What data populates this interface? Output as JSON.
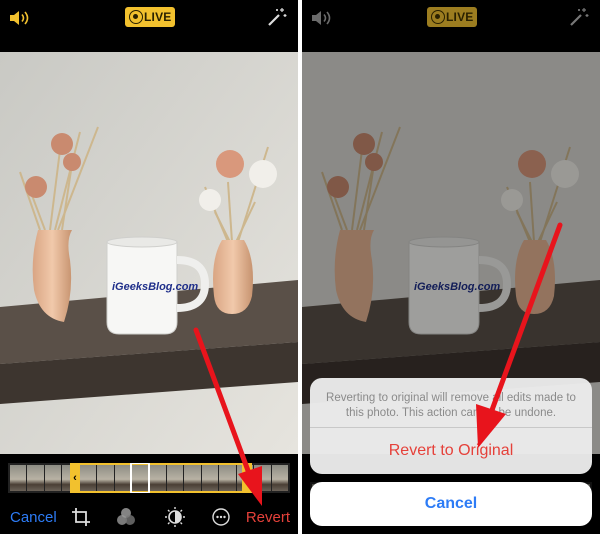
{
  "left_screen": {
    "live_badge": "LIVE",
    "mug_text": "iGeeksBlog.com",
    "toolbar": {
      "cancel_label": "Cancel",
      "revert_label": "Revert",
      "icons": [
        "crop-icon",
        "filters-icon",
        "adjust-icon",
        "more-icon"
      ]
    }
  },
  "right_screen": {
    "live_badge": "LIVE",
    "mug_text": "iGeeksBlog.com",
    "action_sheet": {
      "message": "Reverting to original will remove all edits made to this photo. This action cannot be undone.",
      "revert_button": "Revert to Original",
      "cancel_button": "Cancel"
    }
  },
  "colors": {
    "accent_blue": "#2d7cf6",
    "destructive_red": "#e5413a",
    "live_yellow": "#f2c12e",
    "annotation_arrow": "#e8141c"
  }
}
